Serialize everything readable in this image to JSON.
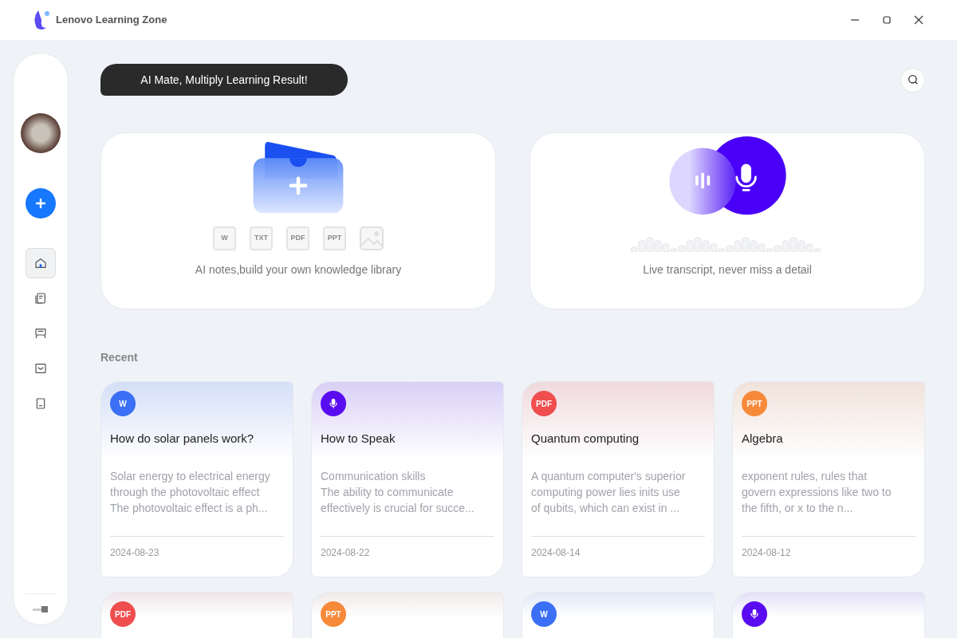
{
  "window": {
    "title": "Lenovo Learning Zone"
  },
  "banner": "AI Mate, Multiply Learning Result!",
  "sidebar": {
    "items": [
      {
        "kind": "home",
        "selected": true
      },
      {
        "kind": "notes",
        "selected": false
      },
      {
        "kind": "board",
        "selected": false
      },
      {
        "kind": "inbox",
        "selected": false
      },
      {
        "kind": "tablet",
        "selected": false
      }
    ]
  },
  "hero_cards": [
    {
      "kind": "upload",
      "caption": "AI notes,build your own knowledge library",
      "file_types": [
        {
          "kind": "doc",
          "label": "W"
        },
        {
          "kind": "doc",
          "label": "TXT"
        },
        {
          "kind": "doc",
          "label": "PDF"
        },
        {
          "kind": "doc",
          "label": "PPT"
        },
        {
          "kind": "image"
        }
      ]
    },
    {
      "kind": "record",
      "caption": "Live transcript, never miss a detail"
    }
  ],
  "recent": {
    "title": "Recent",
    "cards": [
      {
        "kind": "doc",
        "badge": "W",
        "color": "#3b6ff5",
        "title": "How do solar panels work?",
        "lines": [
          "Solar energy to electrical energy",
          "through the photovoltaic effect",
          "The photovoltaic effect is a ph..."
        ],
        "date": "2024-08-23"
      },
      {
        "kind": "audio",
        "color": "#5a0cf0",
        "title": "How to Speak",
        "lines": [
          "Communication skills",
          "The ability to communicate",
          "effectively is crucial for succe..."
        ],
        "date": "2024-08-22"
      },
      {
        "kind": "doc",
        "badge": "PDF",
        "color": "#f04e4e",
        "title": "Quantum computing",
        "lines": [
          "A quantum computer's superior",
          "computing power lies inits use",
          "of qubits, which can exist in ..."
        ],
        "date": "2024-08-14"
      },
      {
        "kind": "doc",
        "badge": "PPT",
        "color": "#f7893a",
        "title": "Algebra",
        "lines": [
          "exponent rules, rules that",
          "govern expressions like two to",
          "the fifth, or x to the n..."
        ],
        "date": "2024-08-12"
      },
      {
        "kind": "doc",
        "badge": "PDF",
        "color": "#f04e4e"
      },
      {
        "kind": "doc",
        "badge": "PPT",
        "color": "#f7893a"
      },
      {
        "kind": "doc",
        "badge": "W",
        "color": "#3b6ff5"
      },
      {
        "kind": "audio",
        "color": "#5a0cf0"
      }
    ]
  }
}
